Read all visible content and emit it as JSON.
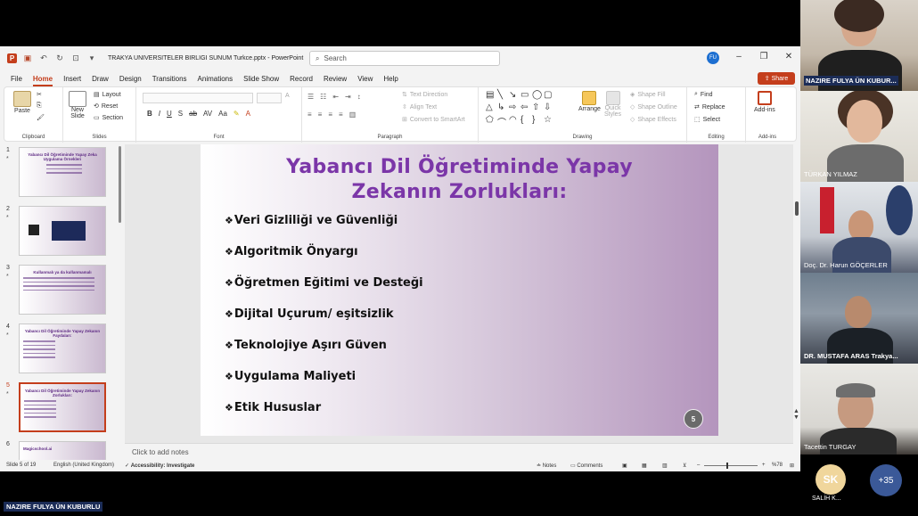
{
  "app": {
    "document_title": "TRAKYA UNIVERSITELER BIRLIGI SUNUM Turkce.pptx - PowerPoint",
    "search_placeholder": "Search",
    "user_initials": "FU",
    "share_label": "Share"
  },
  "menu": [
    "File",
    "Home",
    "Insert",
    "Draw",
    "Design",
    "Transitions",
    "Animations",
    "Slide Show",
    "Record",
    "Review",
    "View",
    "Help"
  ],
  "ribbon": {
    "clipboard": {
      "paste": "Paste",
      "label": "Clipboard"
    },
    "slides": {
      "new_slide_1": "New",
      "new_slide_2": "Slide",
      "layout": "Layout",
      "reset": "Reset",
      "section": "Section",
      "label": "Slides"
    },
    "font": {
      "label": "Font",
      "format_buttons": [
        "B",
        "I",
        "U",
        "S",
        "ab",
        "AV",
        "Aa"
      ]
    },
    "paragraph": {
      "text_direction": "Text Direction",
      "align_text": "Align Text",
      "convert_smartart": "Convert to SmartArt",
      "label": "Paragraph"
    },
    "drawing": {
      "arrange": "Arrange",
      "quick_styles_1": "Quick",
      "quick_styles_2": "Styles",
      "shape_fill": "Shape Fill",
      "shape_outline": "Shape Outline",
      "shape_effects": "Shape Effects",
      "label": "Drawing"
    },
    "editing": {
      "find": "Find",
      "replace": "Replace",
      "select": "Select",
      "label": "Editing"
    },
    "addins": {
      "button": "Add-ins",
      "label": "Add-ins"
    }
  },
  "thumbnails": [
    {
      "number": "1",
      "title": "Yabancı Dil Öğretiminde Yapay Zeka Uygulama Örnekleri"
    },
    {
      "number": "2",
      "title": ""
    },
    {
      "number": "3",
      "title": "Kullanmalı ya da kullanmamalı"
    },
    {
      "number": "4",
      "title": "Yabancı Dil Öğretiminde Yapay Zekanın Faydaları:"
    },
    {
      "number": "5",
      "title": "Yabancı Dil Öğretiminde Yapay Zekanın Zorlukları:"
    },
    {
      "number": "6",
      "title": "Magicschool.ai"
    }
  ],
  "slide": {
    "title_line1": "Yabancı Dil Öğretiminde Yapay",
    "title_line2": "Zekanın Zorlukları:",
    "bullets": [
      "Veri Gizliliği ve Güvenliği",
      "Algoritmik Önyargı",
      "Öğretmen Eğitimi ve Desteği",
      "Dijital Uçurum/ eşitsizlik",
      "Teknolojiye Aşırı Güven",
      "Uygulama Maliyeti",
      "Etik Hususlar"
    ],
    "number": "5"
  },
  "notes_placeholder": "Click to add notes",
  "status": {
    "slide_of": "Slide 5 of 19",
    "language": "English (United Kingdom)",
    "accessibility": "Accessibility: Investigate",
    "notes": "Notes",
    "comments": "Comments",
    "zoom": "%78"
  },
  "participants": [
    {
      "name": "NAZIRE FULYA ÜN KUBUR...",
      "highlight": true
    },
    {
      "name": "TÜRKAN YILMAZ",
      "highlight": false
    },
    {
      "name": "Doç. Dr. Harun GÖÇERLER",
      "highlight": false
    },
    {
      "name": "DR. MUSTAFA ARAS Trakya...",
      "highlight": false
    },
    {
      "name": "Tacettin TURGAY",
      "highlight": false
    }
  ],
  "presenter_label": "NAZIRE FULYA ÜN KUBURLU",
  "avatar": {
    "initials": "SK",
    "name": "SALİH K..."
  },
  "more_count": "+35",
  "colors": {
    "accent": "#c43e1c",
    "slide_title": "#7b36a8",
    "name_badge": "#1b2c57"
  }
}
